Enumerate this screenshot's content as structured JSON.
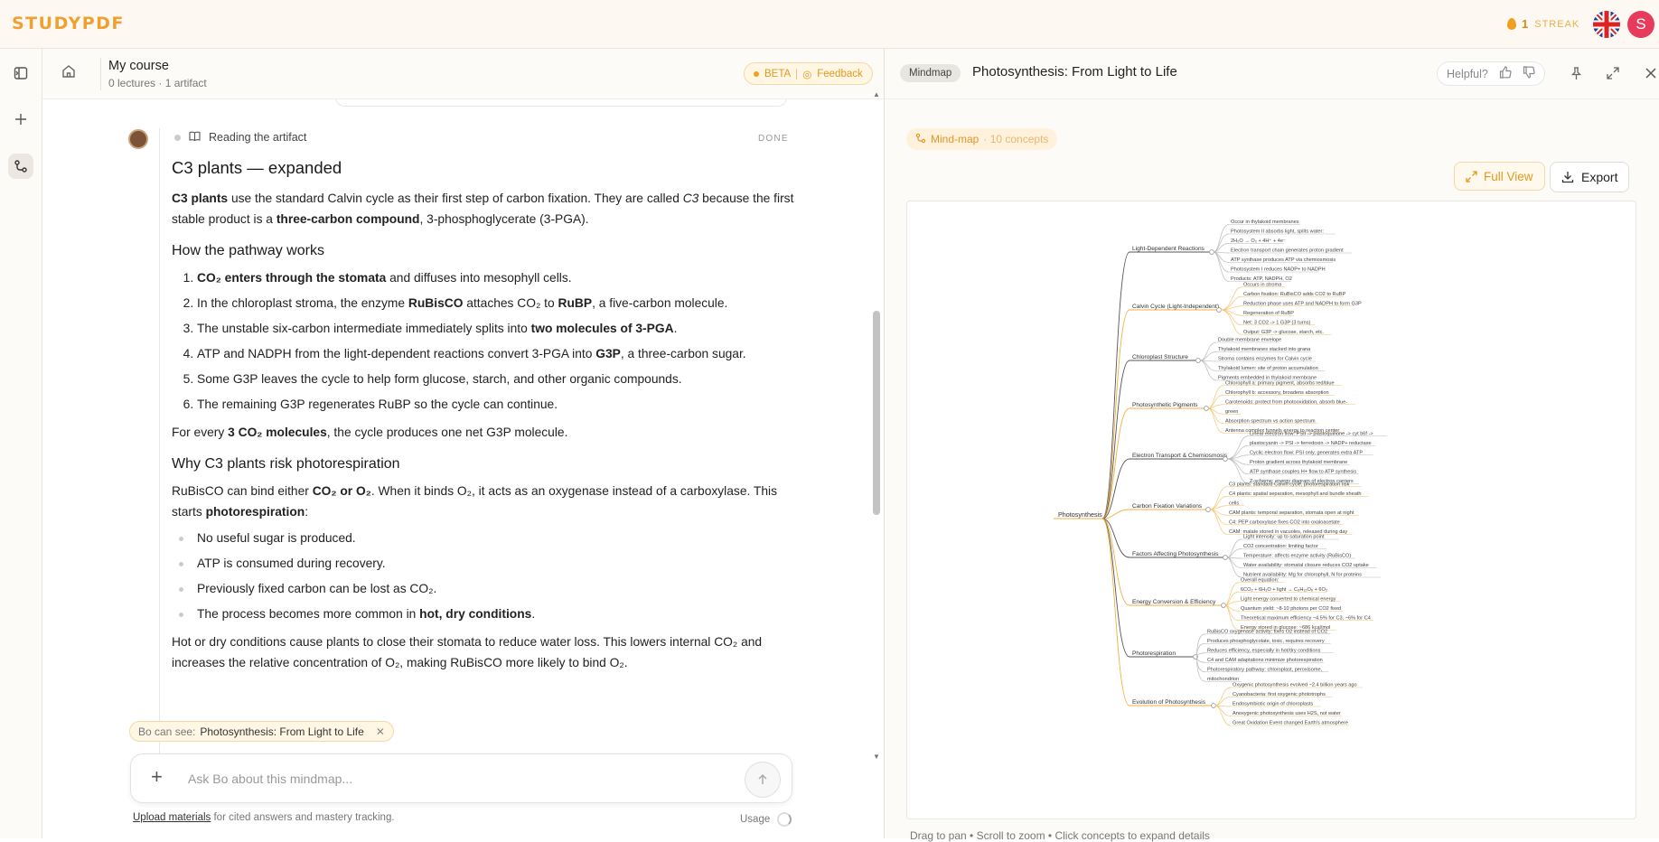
{
  "app": {
    "logo": "STUDYPDF",
    "streak_count": "1",
    "streak_label": "STREAK",
    "avatar_letter": "S"
  },
  "chat": {
    "course_title": "My course",
    "course_meta": "0 lectures · 1 artifact",
    "beta_label": "BETA",
    "feedback_label": "Feedback",
    "status_text": "Reading the artifact",
    "status_done": "DONE",
    "can_see_prefix": "Bo can see:",
    "can_see_item": "Photosynthesis: From Light to Life",
    "input_placeholder": "Ask Bo about this mindmap...",
    "upload_link": "Upload materials",
    "upload_suffix": " for cited answers and mastery tracking.",
    "usage_label": "Usage"
  },
  "panel": {
    "tag": "Mindmap",
    "title": "Photosynthesis: From Light to Life",
    "helpful_label": "Helpful?",
    "chip_label": "Mind-map",
    "chip_count": "· 10 concepts",
    "full_view_label": "Full View",
    "export_label": "Export",
    "hint": "Drag to pan • Scroll to zoom • Click concepts to expand details"
  },
  "mindmap": {
    "root": "Photosynthesis",
    "branches": [
      {
        "label": "Light-Dependent Reactions",
        "children": [
          "Occur in thylakoid membranes",
          "Photosystem II absorbs light, splits water:",
          "2H₂O → O₂ + 4H⁺ + 4e⁻",
          "Electron transport chain generates proton gradient",
          "ATP synthase produces ATP via chemiosmosis",
          "Photosystem I reduces NADP+ to NADPH",
          "Products: ATP, NADPH, O2"
        ]
      },
      {
        "label": "Calvin Cycle (Light-Independent)",
        "children": [
          "Occurs in stroma",
          "Carbon fixation: RuBisCO adds CO2 to RuBP",
          "Reduction phase uses ATP and NADPH to form G3P",
          "Regeneration of RuBP",
          "Net: 3 CO2 -> 1 G3P (3 turns)",
          "Output: G3P -> glucose, starch, etc."
        ]
      },
      {
        "label": "Chloroplast Structure",
        "children": [
          "Double membrane envelope",
          "Thylakoid membranes stacked into grana",
          "Stroma contains enzymes for Calvin cycle",
          "Thylakoid lumen: site of proton accumulation",
          "Pigments embedded in thylakoid membrane"
        ]
      },
      {
        "label": "Photosynthetic Pigments",
        "children": [
          "Chlorophyll a: primary pigment, absorbs red/blue",
          "Chlorophyll b: accessory, broadens absorption",
          "Carotenoids: protect from photooxidation, absorb blue-",
          "green",
          "Absorption spectrum vs action spectrum",
          "Antenna complex funnels energy to reaction center"
        ]
      },
      {
        "label": "Electron Transport & Chemiosmosis",
        "children": [
          "Linear electron flow: PSII -> plastoquinone -> cyt b6f ->",
          "plastocyanin -> PSI -> ferredoxin -> NADP+ reductase",
          "Cyclic electron flow: PSI only, generates extra ATP",
          "Proton gradient across thylakoid membrane",
          "ATP synthase couples H+ flow to ATP synthesis",
          "Z-scheme: energy diagram of electron carriers"
        ]
      },
      {
        "label": "Carbon Fixation Variations",
        "children": [
          "C3 plants: standard Calvin cycle, photorespiration risk",
          "C4 plants: spatial separation, mesophyll and bundle sheath",
          "cells",
          "CAM plants: temporal separation, stomata open at night",
          "C4: PEP carboxylase fixes CO2 into oxaloacetate",
          "CAM: malate stored in vacuoles, released during day"
        ]
      },
      {
        "label": "Factors Affecting Photosynthesis",
        "children": [
          "Light intensity: up to saturation point",
          "CO2 concentration: limiting factor",
          "Temperature: affects enzyme activity (RuBisCO)",
          "Water availability: stomatal closure reduces CO2 uptake",
          "Nutrient availability: Mg for chlorophyll, N for proteins"
        ]
      },
      {
        "label": "Energy Conversion & Efficiency",
        "children": [
          "Overall equation:",
          "6CO₂ + 6H₂O + light → C₆H₁₂O₆ + 6O₂",
          "Light energy converted to chemical energy",
          "Quantum yield: ~8-10 photons per CO2 fixed",
          "Theoretical maximum efficiency ~4.5% for C3, ~6% for C4",
          "Energy stored in glucose: ~686 kcal/mol"
        ]
      },
      {
        "label": "Photorespiration",
        "children": [
          "RuBisCO oxygenase activity: fixes O2 instead of CO2",
          "Produces phosphoglycolate, toxic, requires recovery",
          "Reduces efficiency, especially in hot/dry conditions",
          "C4 and CAM adaptations minimize photorespiration",
          "Photorespiratory pathway: chloroplast, peroxisome,",
          "mitochondrion"
        ]
      },
      {
        "label": "Evolution of Photosynthesis",
        "children": [
          "Oxygenic photosynthesis evolved ~2.4 billion years ago",
          "Cyanobacteria: first oxygenic phototrophs",
          "Endosymbiotic origin of chloroplasts",
          "Anoxygenic photosynthesis uses H2S, not water",
          "Great Oxidation Event changed Earth's atmosphere"
        ]
      }
    ]
  }
}
